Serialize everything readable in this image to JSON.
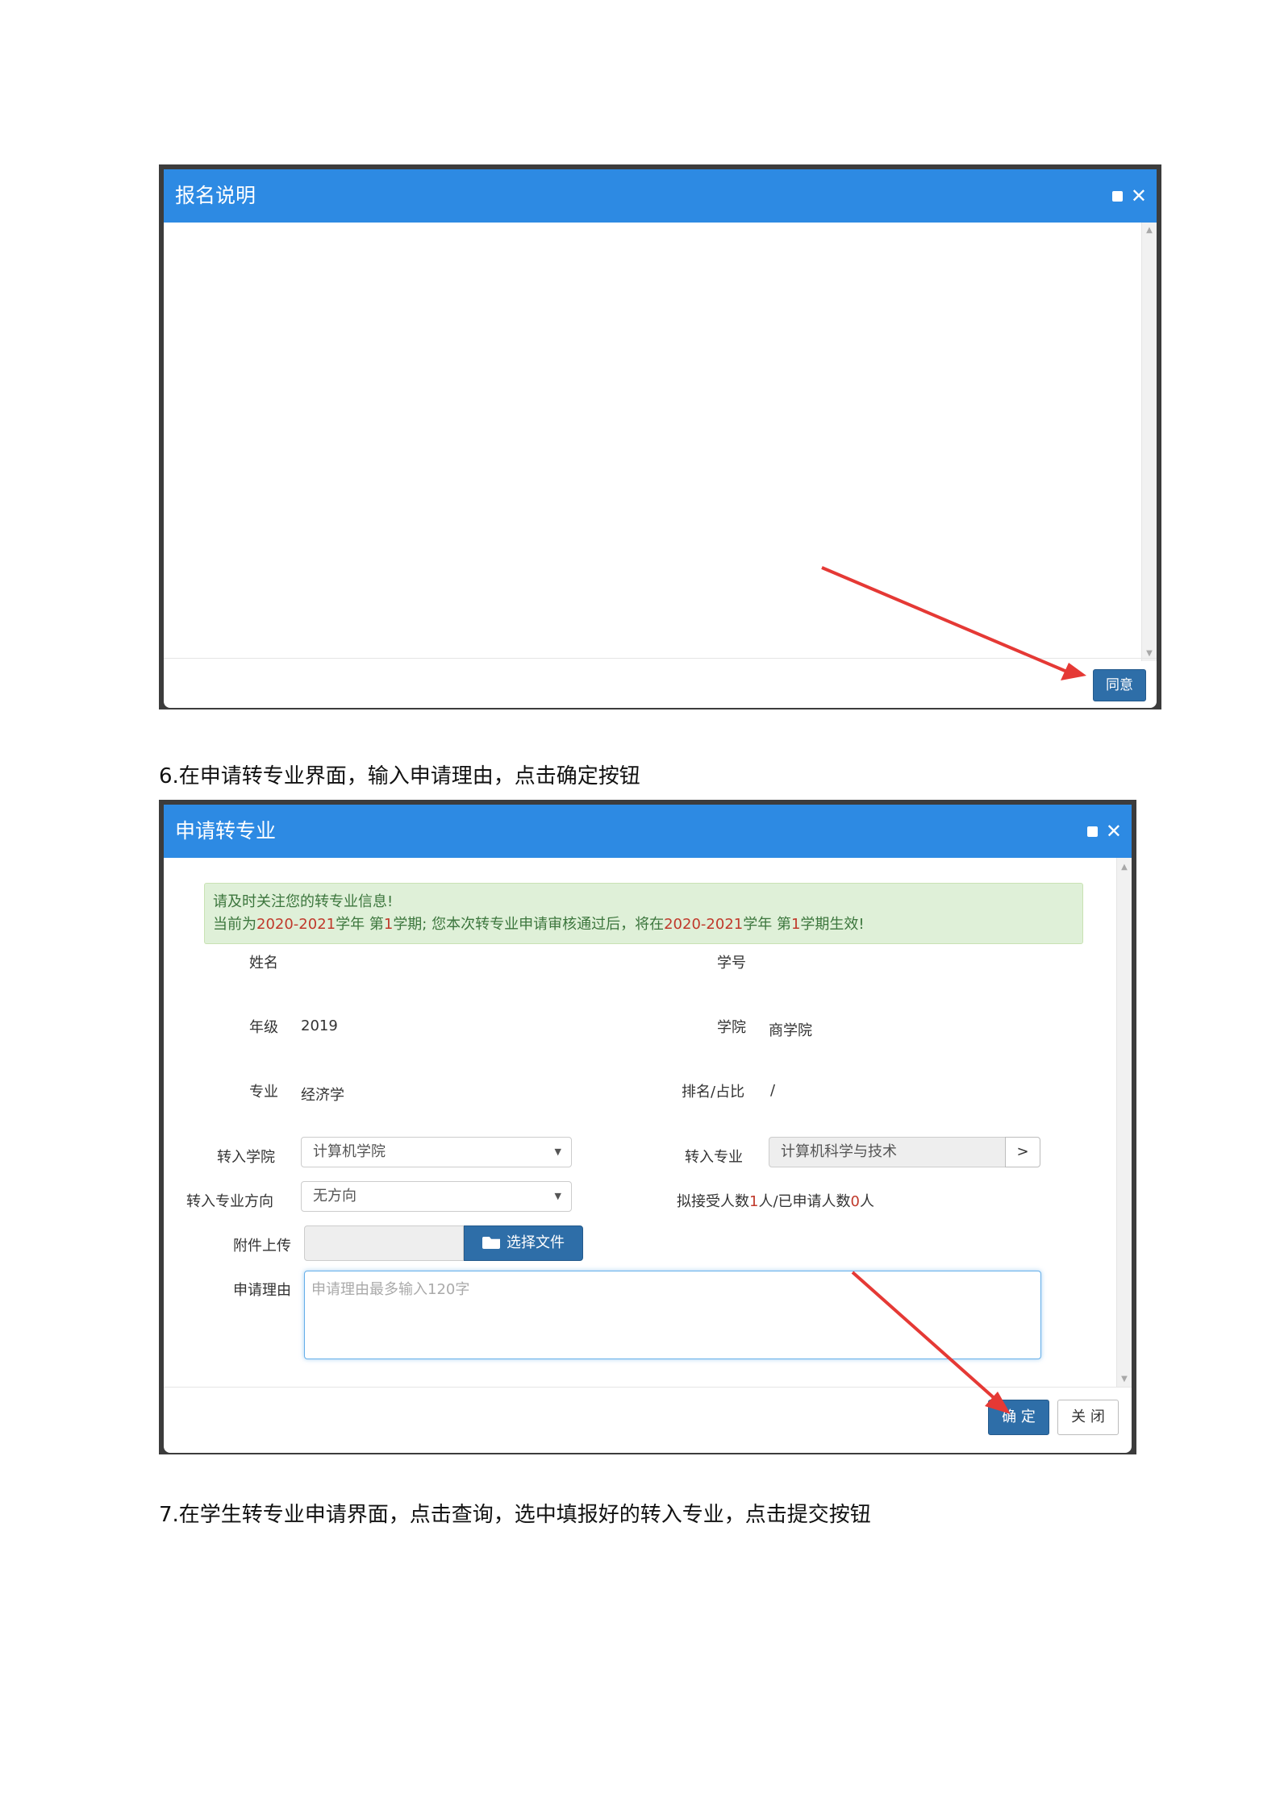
{
  "dialog1": {
    "title": "报名说明",
    "agree_button": "同意"
  },
  "step6_caption": "6.在申请转专业界面，输入申请理由，点击确定按钮",
  "dialog2": {
    "title": "申请转专业",
    "alert_line1": "请及时关注您的转专业信息!",
    "alert_line2_parts": [
      "当前为",
      "2020-2021",
      "学年 第",
      "1",
      "学期; 您本次转专业申请审核通过后，将在",
      "2020-2021",
      "学年 第",
      "1",
      "学期生效!"
    ],
    "fields": {
      "name_label": "姓名",
      "student_no_label": "学号",
      "grade_label": "年级",
      "grade_value": "2019",
      "college_label": "学院",
      "college_value": "商学院",
      "major_label": "专业",
      "major_value": "经济学",
      "rank_label": "排名/占比",
      "rank_value": "/",
      "to_college_label": "转入学院",
      "to_college_value": "计算机学院",
      "to_major_label": "转入专业",
      "to_major_value": "计算机科学与技术",
      "to_major_button": ">",
      "direction_label": "转入专业方向",
      "direction_value": "无方向",
      "quota_parts": [
        "拟接受人数",
        "1",
        "人/已申请人数",
        "0",
        "人"
      ],
      "attach_label": "附件上传",
      "choose_file_button": "选择文件",
      "reason_label": "申请理由",
      "reason_placeholder": "申请理由最多输入120字"
    },
    "confirm_button": "确 定",
    "close_button": "关 闭"
  },
  "step7_caption": "7.在学生转专业申请界面，点击查询，选中填报好的转入专业，点击提交按钮"
}
